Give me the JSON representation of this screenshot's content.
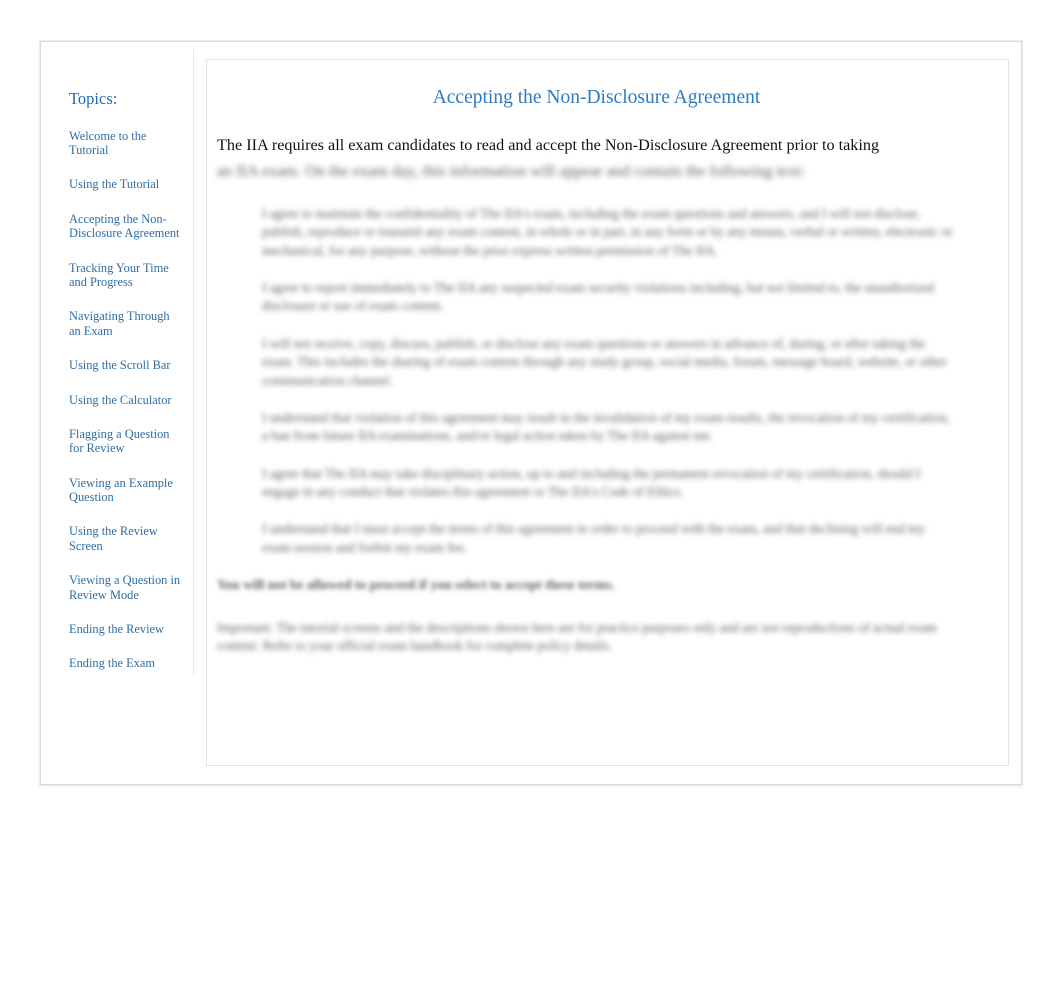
{
  "sidebar": {
    "heading": "Topics:",
    "items": [
      {
        "label": "Welcome to the Tutorial",
        "name": "sidebar-item-welcome-to-the-tutorial"
      },
      {
        "label": "Using the Tutorial",
        "name": "sidebar-item-using-the-tutorial"
      },
      {
        "label": "Accepting the Non-Disclosure Agreement",
        "name": "sidebar-item-accepting-the-non-disclosure-agreement"
      },
      {
        "label": "Tracking Your Time and Progress",
        "name": "sidebar-item-tracking-your-time-and-progress"
      },
      {
        "label": "Navigating Through an Exam",
        "name": "sidebar-item-navigating-through-an-exam"
      },
      {
        "label": "Using the Scroll Bar",
        "name": "sidebar-item-using-the-scroll-bar"
      },
      {
        "label": "Using the Calculator",
        "name": "sidebar-item-using-the-calculator"
      },
      {
        "label": "Flagging a Question for Review",
        "name": "sidebar-item-flagging-a-question-for-review"
      },
      {
        "label": "Viewing an Example Question",
        "name": "sidebar-item-viewing-an-example-question"
      },
      {
        "label": "Using the Review Screen",
        "name": "sidebar-item-using-the-review-screen"
      },
      {
        "label": "Viewing a Question in Review Mode",
        "name": "sidebar-item-viewing-a-question-in-review-mode"
      },
      {
        "label": "Ending the Review",
        "name": "sidebar-item-ending-the-review"
      },
      {
        "label": "Ending the Exam",
        "name": "sidebar-item-ending-the-exam"
      }
    ]
  },
  "content": {
    "title": "Accepting the Non-Disclosure Agreement",
    "intro_paragraph": "The IIA requires all exam candidates to read and accept the Non-Disclosure Agreement prior to taking",
    "lead_continuation": "an IIA exam. On the exam day, this information will appear and contain the following text:",
    "bullets": [
      "I agree to maintain the confidentiality of The IIA's exam, including the exam questions and answers, and I will not disclose, publish, reproduce or transmit any exam content, in whole or in part, in any form or by any means, verbal or written, electronic or mechanical, for any purpose, without the prior express written permission of The IIA.",
      "I agree to report immediately to The IIA any suspected exam security violations including, but not limited to, the unauthorized disclosure or use of exam content.",
      "I will not receive, copy, discuss, publish, or disclose any exam questions or answers in advance of, during, or after taking the exam. This includes the sharing of exam content through any study group, social media, forum, message board, website, or other communication channel.",
      "I understand that violation of this agreement may result in the invalidation of my exam results, the revocation of my certification, a ban from future IIA examinations, and/or legal action taken by The IIA against me.",
      "I agree that The IIA may take disciplinary action, up to and including the permanent revocation of my certification, should I engage in any conduct that violates this agreement or The IIA's Code of Ethics.",
      "I understand that I must accept the terms of this agreement in order to proceed with the exam, and that declining will end my exam session and forfeit my exam fee."
    ],
    "bold_notice": "You will not be allowed to proceed if you select to accept these terms.",
    "closing_paragraph": "Important: The tutorial screens and the descriptions shown here are for practice purposes only and are not reproductions of actual exam content. Refer to your official exam handbook for complete policy details."
  }
}
